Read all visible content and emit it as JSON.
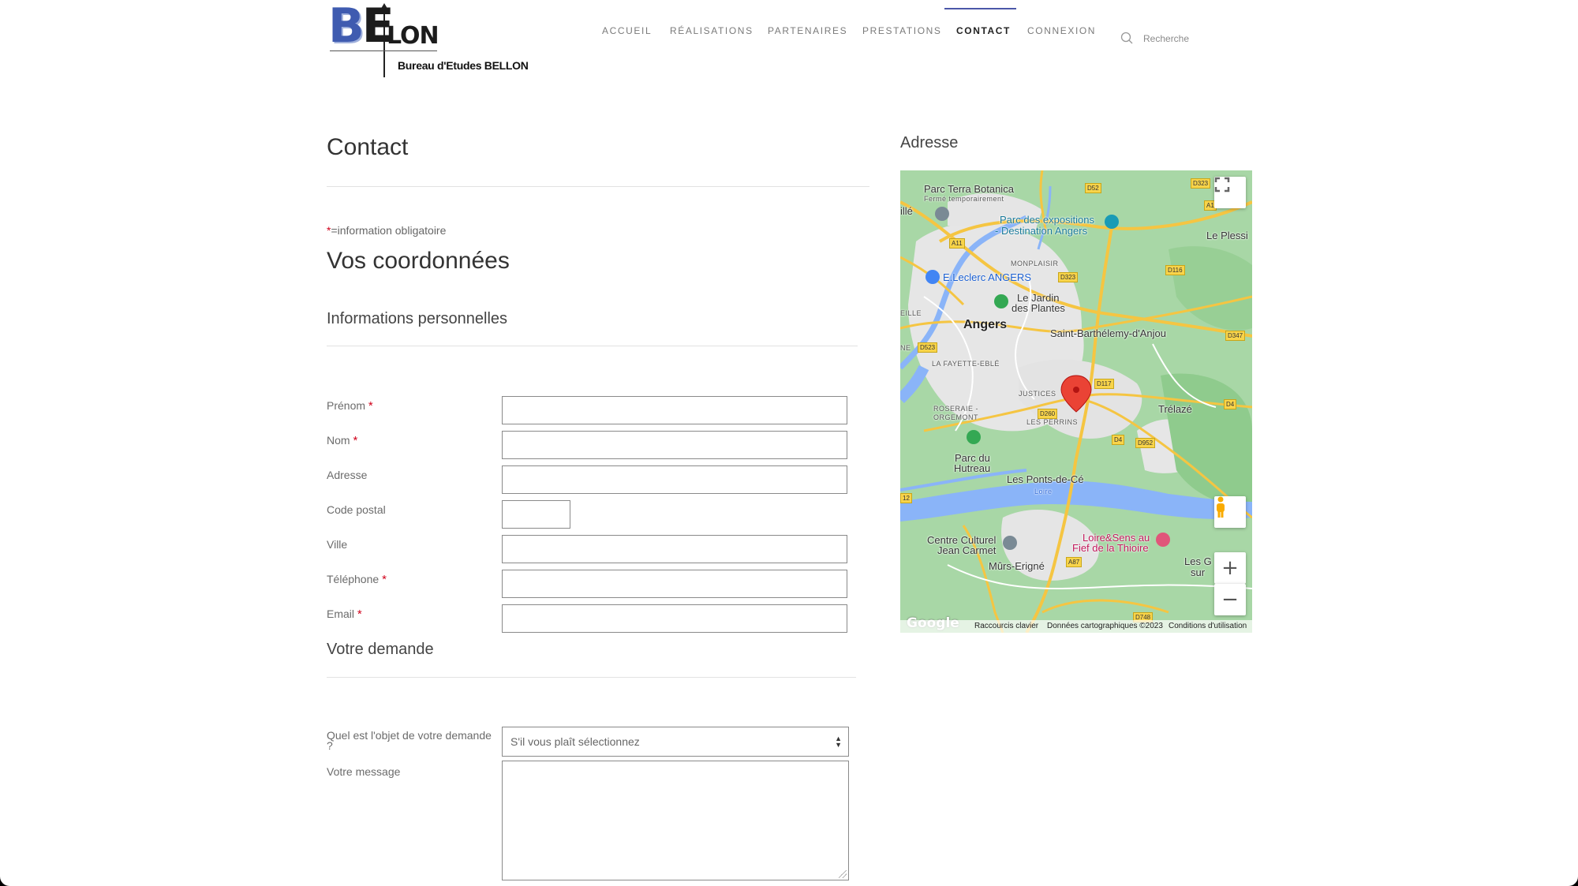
{
  "logo": {
    "big_b": "B",
    "big_e": "E",
    "lon": "LON",
    "subtitle": "Bureau d'Etudes BELLON"
  },
  "nav": {
    "items": [
      "ACCUEIL",
      "RÉALISATIONS",
      "PARTENAIRES",
      "PRESTATIONS",
      "CONTACT",
      "CONNEXION"
    ],
    "active": "CONTACT",
    "search_label": "Recherche"
  },
  "page": {
    "title": "Contact",
    "required_star": "*",
    "required_note": "=information obligatoire",
    "section_title": "Vos coordonnées",
    "personal_title": "Informations personnelles",
    "request_title": "Votre demande"
  },
  "form": {
    "fields": [
      {
        "label": "Prénom",
        "required": "*"
      },
      {
        "label": "Nom",
        "required": "*"
      },
      {
        "label": "Adresse",
        "required": ""
      },
      {
        "label": "Code postal",
        "required": ""
      },
      {
        "label": "Ville",
        "required": ""
      },
      {
        "label": "Téléphone",
        "required": "*"
      },
      {
        "label": "Email",
        "required": "*"
      }
    ],
    "subject_label": "Quel est l'objet de votre demande ?",
    "subject_value": "S'il vous plaît sélectionnez",
    "message_label": "Votre message"
  },
  "map": {
    "title": "Adresse",
    "labels": {
      "terra": "Parc Terra Botanica",
      "terra_sub": "Fermé temporairement",
      "expo": "Parc des expositions",
      "expo2": "- Destination Angers",
      "leclerc": "E.Leclerc ANGERS",
      "monplaisir": "MONPLAISIR",
      "jardin1": "Le Jardin",
      "jardin2": "des Plantes",
      "angers": "Angers",
      "stbarth": "Saint-Barthélemy-d'Anjou",
      "lafayette": "LA FAYETTE-EBLÉ",
      "justices": "JUSTICES",
      "roseraie1": "ROSERAIE -",
      "roseraie2": "ORGEMONT",
      "perrins": "LES PERRINS",
      "trelaze": "Trélazé",
      "hutreau1": "Parc du",
      "hutreau2": "Hutreau",
      "ponts": "Les Ponts-de-Cé",
      "loire": "Loire",
      "centre1": "Centre Culturel",
      "centre2": "Jean Carmet",
      "loiresens1": "Loire&Sens au",
      "loiresens2": "Fief de la Thioire",
      "murs": "Mûrs-Erigné",
      "plessis": "Le Plessi",
      "ille": "illé",
      "eille": "EILLE",
      "ne": "NE",
      "lesg": "Les G",
      "lesg2": "sur"
    },
    "roads": [
      "D52",
      "D323",
      "A11",
      "D323",
      "D116",
      "D347",
      "D523",
      "D117",
      "D4",
      "D260",
      "D4",
      "D952",
      "A87",
      "D748",
      "12",
      "A1"
    ],
    "footer": {
      "shortcuts": "Raccourcis clavier",
      "data": "Données cartographiques ©2023",
      "terms": "Conditions d'utilisation"
    },
    "google": "Google"
  }
}
